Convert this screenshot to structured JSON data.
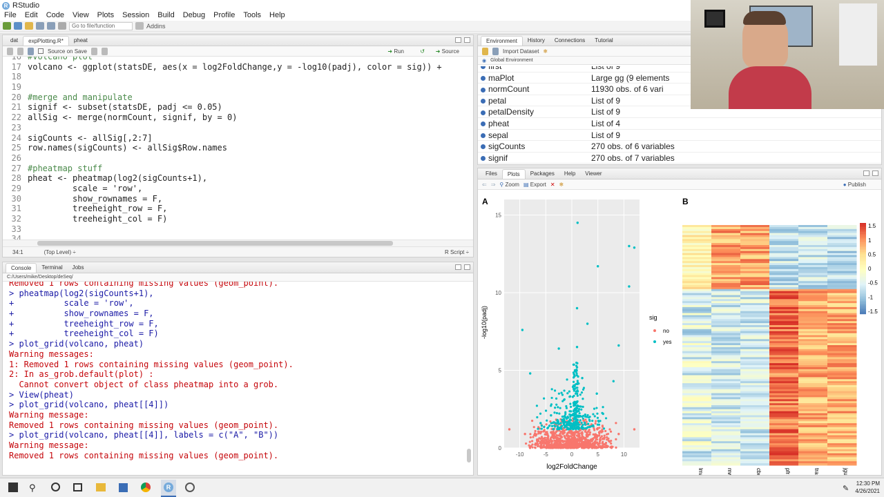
{
  "app": {
    "title": "RStudio"
  },
  "menu": [
    "File",
    "Edit",
    "Code",
    "View",
    "Plots",
    "Session",
    "Build",
    "Debug",
    "Profile",
    "Tools",
    "Help"
  ],
  "toolbar": {
    "goto_placeholder": "Go to file/function",
    "addins": "Addins"
  },
  "source": {
    "tabs": [
      "dat",
      "expPlotting.R*",
      "pheat"
    ],
    "run": "Run",
    "source_btn": "Source",
    "source_on_save": "Source on Save",
    "lines": [
      {
        "n": "16",
        "t": "#volcano plot",
        "c": "cm"
      },
      {
        "n": "17",
        "t": "volcano <- ggplot(statsDE, aes(x = log2FoldChange,y = -log10(padj), color = sig)) +",
        "c": ""
      },
      {
        "n": "18",
        "t": "",
        "c": ""
      },
      {
        "n": "19",
        "t": "",
        "c": ""
      },
      {
        "n": "20",
        "t": "#merge and manipulate",
        "c": "cm"
      },
      {
        "n": "21",
        "t": "signif <- subset(statsDE, padj <= 0.05)",
        "c": ""
      },
      {
        "n": "22",
        "t": "allSig <- merge(normCount, signif, by = 0)",
        "c": ""
      },
      {
        "n": "23",
        "t": "",
        "c": ""
      },
      {
        "n": "24",
        "t": "sigCounts <- allSig[,2:7]",
        "c": ""
      },
      {
        "n": "25",
        "t": "row.names(sigCounts) <- allSig$Row.names",
        "c": ""
      },
      {
        "n": "26",
        "t": "",
        "c": ""
      },
      {
        "n": "27",
        "t": "#pheatmap stuff",
        "c": "cm"
      },
      {
        "n": "28",
        "t": "pheat <- pheatmap(log2(sigCounts+1),",
        "c": ""
      },
      {
        "n": "29",
        "t": "         scale = 'row',",
        "c": ""
      },
      {
        "n": "30",
        "t": "         show_rownames = F,",
        "c": ""
      },
      {
        "n": "31",
        "t": "         treeheight_row = F,",
        "c": ""
      },
      {
        "n": "32",
        "t": "         treeheight_col = F)",
        "c": ""
      },
      {
        "n": "33",
        "t": "",
        "c": ""
      },
      {
        "n": "34",
        "t": "",
        "c": ""
      },
      {
        "n": "35",
        "t": "",
        "c": ""
      }
    ],
    "status_pos": "34:1",
    "status_scope": "(Top Level) ÷",
    "status_type": "R Script ÷"
  },
  "console": {
    "tabs": [
      "Console",
      "Terminal",
      "Jobs"
    ],
    "path": "C:/Users/mike/Desktop/deSeq/",
    "lines": [
      {
        "t": "Removed 1 rows containing missing values (geom_point).",
        "c": "warn"
      },
      {
        "t": "> pheatmap(log2(sigCounts+1),",
        "c": "cmd"
      },
      {
        "t": "+          scale = 'row',",
        "c": "cmd"
      },
      {
        "t": "+          show_rownames = F,",
        "c": "cmd"
      },
      {
        "t": "+          treeheight_row = F,",
        "c": "cmd"
      },
      {
        "t": "+          treeheight_col = F)",
        "c": "cmd"
      },
      {
        "t": "> plot_grid(volcano, pheat)",
        "c": "cmd"
      },
      {
        "t": "Warning messages:",
        "c": "warn"
      },
      {
        "t": "1: Removed 1 rows containing missing values (geom_point).",
        "c": "warn"
      },
      {
        "t": "2: In as_grob.default(plot) :",
        "c": "warn"
      },
      {
        "t": "  Cannot convert object of class pheatmap into a grob.",
        "c": "warn"
      },
      {
        "t": "> View(pheat)",
        "c": "cmd"
      },
      {
        "t": "> plot_grid(volcano, pheat[[4]])",
        "c": "cmd"
      },
      {
        "t": "Warning message:",
        "c": "warn"
      },
      {
        "t": "Removed 1 rows containing missing values (geom_point).",
        "c": "warn"
      },
      {
        "t": "> plot_grid(volcano, pheat[[4]], labels = c(\"A\", \"B\"))",
        "c": "cmd"
      },
      {
        "t": "Warning message:",
        "c": "warn"
      },
      {
        "t": "Removed 1 rows containing missing values (geom_point).",
        "c": "warn"
      },
      {
        "t": "> ",
        "c": "cmd"
      }
    ]
  },
  "env": {
    "tabs": [
      "Environment",
      "History",
      "Connections",
      "Tutorial"
    ],
    "import": "Import Dataset",
    "scope": "Global Environment",
    "rows": [
      {
        "name": "first",
        "value": "List of 9"
      },
      {
        "name": "maPlot",
        "value": "Large gg (9 elements"
      },
      {
        "name": "normCount",
        "value": "11930 obs. of 6 vari"
      },
      {
        "name": "petal",
        "value": "List of 9"
      },
      {
        "name": "petalDensity",
        "value": "List of 9"
      },
      {
        "name": "pheat",
        "value": "List of 4"
      },
      {
        "name": "sepal",
        "value": "List of 9"
      },
      {
        "name": "sigCounts",
        "value": "270 obs. of 6 variables"
      },
      {
        "name": "signif",
        "value": "270 obs. of 7 variables"
      }
    ]
  },
  "files": {
    "tabs": [
      "Files",
      "Plots",
      "Packages",
      "Help",
      "Viewer"
    ],
    "zoom": "Zoom",
    "export": "Export",
    "publish": "Publish"
  },
  "chart_data": [
    {
      "type": "scatter",
      "panel_label": "A",
      "xlabel": "log2FoldChange",
      "ylabel": "-log10(padj)",
      "xlim": [
        -13,
        13
      ],
      "ylim": [
        0,
        16
      ],
      "xticks": [
        "-10",
        "-5",
        "0",
        "5",
        "10"
      ],
      "yticks": [
        "0",
        "5",
        "10",
        "15"
      ],
      "legend_title": "sig",
      "legend": [
        "no",
        "yes"
      ],
      "colors": {
        "no": "#F8766D",
        "yes": "#00BFC4"
      },
      "series": [
        {
          "name": "yes",
          "points": [
            [
              1.1,
              14.5
            ],
            [
              11,
              13
            ],
            [
              12,
              12.9
            ],
            [
              5,
              11.7
            ],
            [
              11,
              10.4
            ],
            [
              1,
              9
            ],
            [
              3,
              8
            ],
            [
              -9.5,
              7.6
            ],
            [
              9,
              6.6
            ],
            [
              -2.5,
              6.4
            ],
            [
              1,
              6.5
            ],
            [
              -8,
              4.8
            ],
            [
              2,
              4.5
            ],
            [
              8,
              4.3
            ],
            [
              0.6,
              5
            ],
            [
              1.2,
              4.6
            ],
            [
              4.8,
              3.5
            ],
            [
              -4,
              2.1
            ],
            [
              6,
              2.2
            ],
            [
              -6,
              1.6
            ]
          ]
        },
        {
          "name": "no",
          "points": [
            [
              -12,
              1.2
            ],
            [
              12,
              1.2
            ],
            [
              -6,
              0.6
            ],
            [
              6,
              0.6
            ],
            [
              -3,
              0.4
            ],
            [
              3,
              0.4
            ],
            [
              0,
              0.2
            ],
            [
              -9,
              0.9
            ],
            [
              9,
              0.9
            ],
            [
              -1,
              0.8
            ],
            [
              1,
              0.8
            ]
          ]
        }
      ]
    },
    {
      "type": "heatmap",
      "panel_label": "B",
      "columns": [
        "lmaha_15psu",
        "mwenz_15psu",
        "cbola_15psu",
        "pfraz_water",
        "trasc_water",
        "jgult_water"
      ],
      "colorbar_ticks": [
        "1.5",
        "1",
        "0.5",
        "0",
        "-0.5",
        "-1",
        "-1.5"
      ],
      "rows": 270
    }
  ],
  "taskbar": {
    "time": "12:30 PM",
    "date": "4/26/2021"
  }
}
